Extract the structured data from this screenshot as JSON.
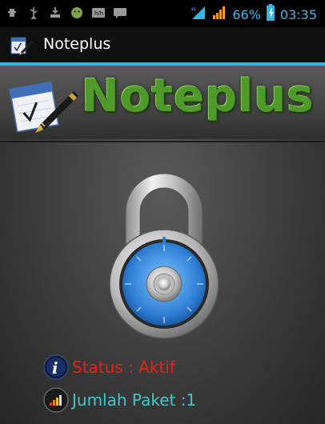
{
  "statusbar": {
    "battery": "66%",
    "time": "03:35",
    "left_icons": [
      "usb-debug-icon",
      "usb-icon",
      "download-icon",
      "android-icon",
      "sim-h-icon",
      "sms-icon"
    ]
  },
  "actionbar": {
    "title": "Noteplus"
  },
  "banner": {
    "title": "Noteplus"
  },
  "info": {
    "status_label": "Status : Aktif",
    "paket_label": "Jumlah Paket :1"
  },
  "colors": {
    "accent": "#33b5e5",
    "status_text": "#e8231c",
    "paket_text": "#3ec8cc",
    "logo_green": "#4f9a2b"
  }
}
